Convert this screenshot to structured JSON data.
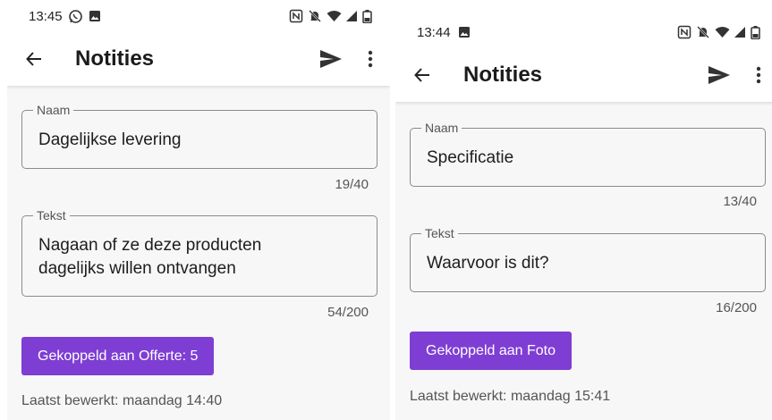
{
  "screens": [
    {
      "status": {
        "time": "13:45"
      },
      "appbar": {
        "title": "Notities"
      },
      "name_field": {
        "label": "Naam",
        "value": "Dagelijkse levering",
        "counter": "19/40"
      },
      "text_field": {
        "label": "Tekst",
        "value": "Nagaan of ze deze producten dagelijks willen ontvangen",
        "counter": "54/200"
      },
      "linked_button": "Gekoppeld aan Offerte: 5",
      "last_edited": "Laatst bewerkt: maandag 14:40"
    },
    {
      "status": {
        "time": "13:44"
      },
      "appbar": {
        "title": "Notities"
      },
      "name_field": {
        "label": "Naam",
        "value": "Specificatie",
        "counter": "13/40"
      },
      "text_field": {
        "label": "Tekst",
        "value": "Waarvoor is dit?",
        "counter": "16/200"
      },
      "linked_button": "Gekoppeld aan Foto",
      "last_edited": "Laatst bewerkt: maandag 15:41"
    }
  ],
  "icons": {
    "back": "arrow-back-icon",
    "send": "send-icon",
    "more": "more-vert-icon",
    "whatsapp": "whatsapp-icon",
    "gallery": "gallery-icon",
    "nfc": "nfc-icon",
    "mute": "mute-icon",
    "wifi": "wifi-icon",
    "signal": "signal-icon",
    "battery": "battery-icon"
  },
  "colors": {
    "accent": "#7e3ed3",
    "background": "#f7f7f8",
    "outline": "#8a8a8a"
  }
}
